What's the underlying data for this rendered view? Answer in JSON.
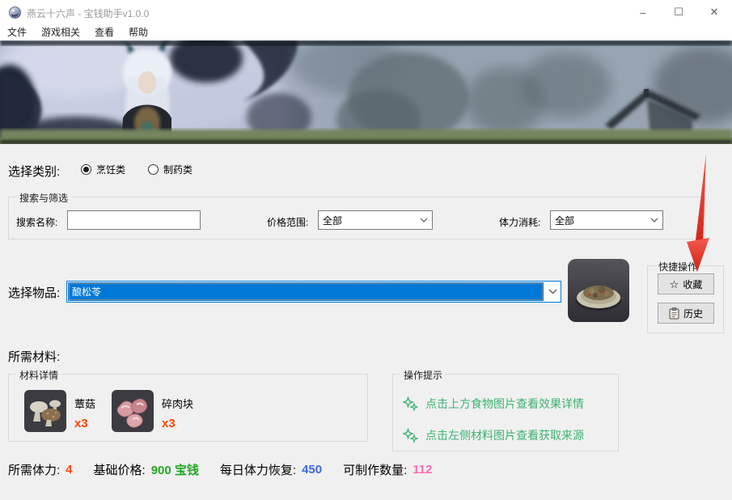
{
  "window": {
    "title": "燕云十六声 - 宝钱助手v1.0.0",
    "minimize_glyph": "–",
    "maximize_glyph": "☐",
    "close_glyph": "✕"
  },
  "menu": {
    "items": [
      {
        "label": "文件"
      },
      {
        "label": "游戏相关"
      },
      {
        "label": "查看"
      },
      {
        "label": "帮助"
      }
    ]
  },
  "category": {
    "label": "选择类别:",
    "options": [
      {
        "label": "烹饪类",
        "checked": true
      },
      {
        "label": "制药类",
        "checked": false
      }
    ]
  },
  "filter": {
    "group_title": "搜索与筛选",
    "search_label": "搜索名称:",
    "search_value": "",
    "price_label": "价格范围:",
    "price_value": "全部",
    "stamina_label": "体力消耗:",
    "stamina_value": "全部"
  },
  "item_select": {
    "label": "选择物品:",
    "value": "酿松苓"
  },
  "quick_actions": {
    "group_title": "快捷操作",
    "favorite_label": "收藏",
    "favorite_icon": "☆",
    "history_label": "历史"
  },
  "materials": {
    "section_label": "所需材料:",
    "group_title": "材料详情",
    "items": [
      {
        "name": "蕈菇",
        "count": "x3"
      },
      {
        "name": "碎肉块",
        "count": "x3"
      }
    ]
  },
  "tips": {
    "group_title": "操作提示",
    "items": [
      {
        "text": "点击上方食物图片查看效果详情"
      },
      {
        "text": "点击左侧材料图片查看获取来源"
      }
    ]
  },
  "status": {
    "stamina_label": "所需体力:",
    "stamina_value": "4",
    "price_label": "基础价格:",
    "price_value": "900 宝钱",
    "recover_label": "每日体力恢复:",
    "recover_value": "450",
    "craft_label": "可制作数量:",
    "craft_value": "112"
  },
  "colors": {
    "selection_blue": "#0078d7",
    "tip_green": "#3cb371",
    "stamina_red": "#ff4500",
    "price_green": "#22a822",
    "recover_blue": "#4169e1",
    "craft_pink": "#ff69b4",
    "count_red": "#ff4500",
    "arrow_red": "#e5352b"
  }
}
